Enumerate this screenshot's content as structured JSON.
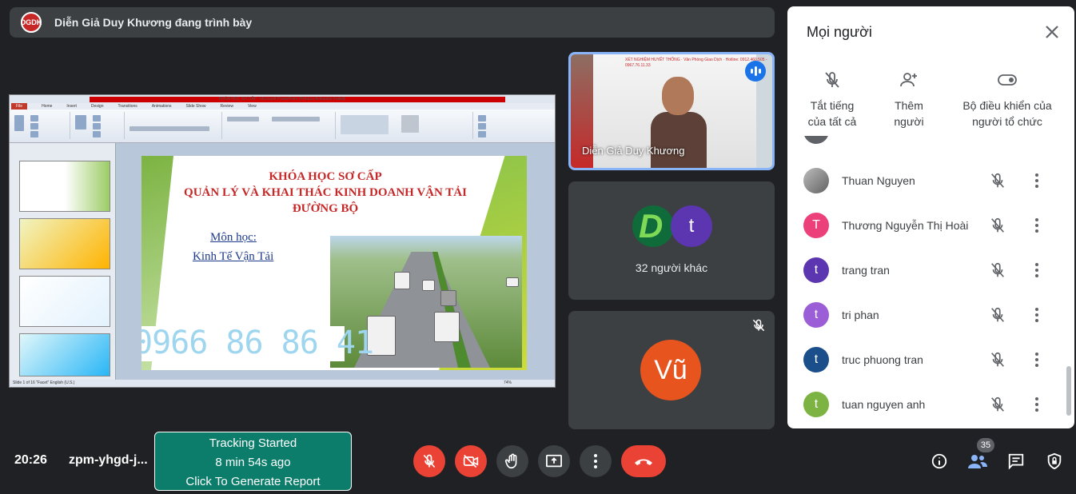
{
  "banner": {
    "logo_text": "DGDK",
    "title": "Diễn Giả Duy Khương đang trình bày"
  },
  "slide": {
    "course_title_line1": "KHÓA HỌC SƠ CẤP",
    "course_title_line2": "QUẢN LÝ VÀ KHAI THÁC KINH DOANH VẬN TẢI",
    "course_title_line3": "ĐƯỜNG BỘ",
    "subject_label": "Môn học:",
    "subject_name": "Kinh Tế Vận Tải",
    "phone": "0966 86 86 41",
    "ppt_title": "KHÓA HỌC SƠ CẤP - Microsoft PowerPoint (Product Activation Failed)",
    "ppt_tabs": [
      "File",
      "Home",
      "Insert",
      "Design",
      "Transitions",
      "Animations",
      "Slide Show",
      "Review",
      "View"
    ],
    "ppt_status": "Slide 1 of 16    \"Facet\"    English (U.S.)",
    "ppt_zoom": "74%"
  },
  "tiles": {
    "speaker_name": "Diễn Giả Duy Khương",
    "speaker_poster_text": "XÉT NGHIỆM HUYẾT THỐNG · Văn Phòng Giao Dịch · Hotline: 0912.460.505 - 0967.76.11.33",
    "others_avatar_t": "t",
    "others_label": "32 người khác",
    "vu_initials": "Vũ"
  },
  "panel": {
    "title": "Mọi người",
    "actions": [
      {
        "line1": "Tắt tiếng",
        "line2": "của tất cả"
      },
      {
        "line1": "Thêm",
        "line2": "người"
      },
      {
        "line1": "Bộ điều khiển của",
        "line2": "người tổ chức"
      }
    ],
    "people": [
      {
        "name": "Thuan Nguyen",
        "initial": "",
        "color": "#9e9e9e"
      },
      {
        "name": "Thương Nguyễn Thị Hoài",
        "initial": "T",
        "color": "#ec407a"
      },
      {
        "name": "trang tran",
        "initial": "t",
        "color": "#5c35b0"
      },
      {
        "name": "tri phan",
        "initial": "t",
        "color": "#9c5ed6"
      },
      {
        "name": "truc phuong tran",
        "initial": "t",
        "color": "#1a4f8b"
      },
      {
        "name": "tuan nguyen anh",
        "initial": "t",
        "color": "#7cb342"
      }
    ]
  },
  "bottom": {
    "time": "20:26",
    "meeting_code": "zpm-yhgd-j...",
    "tracking_line1": "Tracking Started",
    "tracking_line2": "8 min 54s ago",
    "tracking_line3": "Click To Generate Report",
    "participant_count": "35"
  },
  "colors": {
    "end_call": "#ea4335",
    "accent": "#8ab4f8",
    "tracking": "#0b7d6a"
  }
}
